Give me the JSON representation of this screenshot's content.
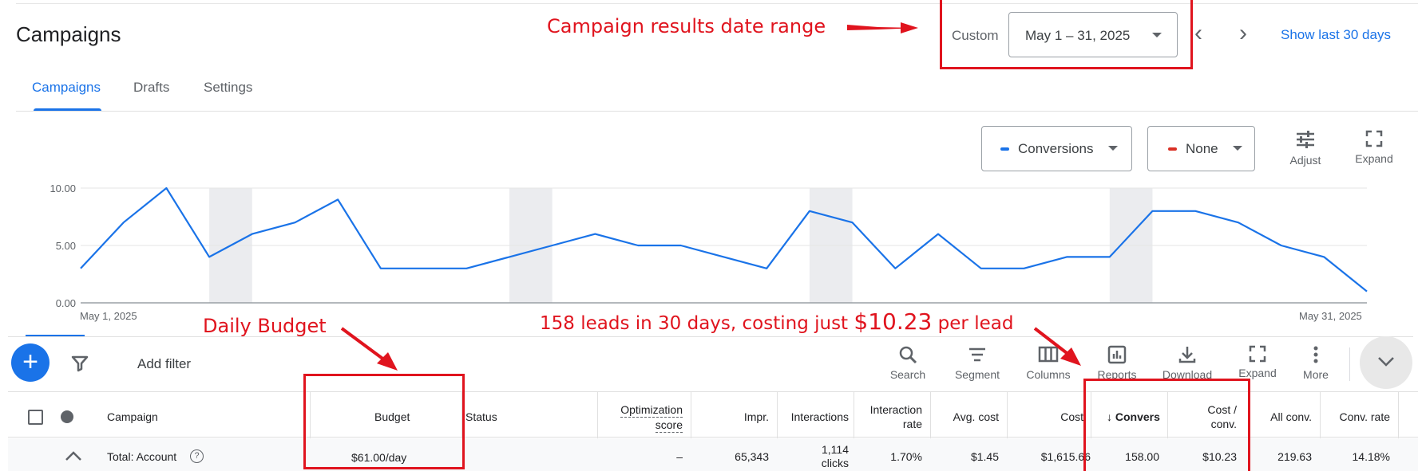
{
  "header": {
    "title": "Campaigns",
    "date_mode": "Custom",
    "date_range": "May 1 – 31, 2025",
    "show_last_label": "Show last 30 days"
  },
  "tabs": [
    {
      "label": "Campaigns",
      "active": true
    },
    {
      "label": "Drafts",
      "active": false
    },
    {
      "label": "Settings",
      "active": false
    }
  ],
  "chart_controls": {
    "metric1": {
      "label": "Conversions",
      "color": "#1a73e8"
    },
    "metric2": {
      "label": "None",
      "color": "#d93025"
    },
    "adjust_label": "Adjust",
    "expand_label": "Expand"
  },
  "chart_data": {
    "type": "line",
    "y_ticks": [
      "10.00",
      "5.00",
      "0.00"
    ],
    "ylim": [
      0,
      10
    ],
    "x_start_label": "May 1, 2025",
    "x_end_label": "May 31, 2025",
    "series": [
      {
        "color": "#1a73e8",
        "values": [
          3,
          7,
          10,
          4,
          6,
          7,
          9,
          3,
          3,
          3,
          4,
          5,
          6,
          5,
          5,
          4,
          3,
          8,
          7,
          3,
          6,
          3,
          3,
          4,
          4,
          8,
          8,
          7,
          5,
          4,
          1
        ]
      }
    ],
    "weekend_bands": [
      [
        3,
        4
      ],
      [
        10,
        11
      ],
      [
        17,
        18
      ],
      [
        24,
        25
      ]
    ]
  },
  "toolbar": {
    "add_filter": "Add filter",
    "tools": [
      "Search",
      "Segment",
      "Columns",
      "Reports",
      "Download",
      "Expand",
      "More"
    ]
  },
  "table": {
    "headers": {
      "campaign": "Campaign",
      "budget": "Budget",
      "status": "Status",
      "opt_score_1": "Optimization",
      "opt_score_2": "score",
      "impr": "Impr.",
      "interactions": "Interactions",
      "int_rate_1": "Interaction",
      "int_rate_2": "rate",
      "avg_cost": "Avg. cost",
      "cost": "Cost",
      "conversions": "Convers",
      "cost_conv_1": "Cost /",
      "cost_conv_2": "conv.",
      "all_conv": "All conv.",
      "conv_rate": "Conv. rate"
    },
    "total": {
      "label": "Total: Account",
      "budget": "$61.00/day",
      "opt_score": "–",
      "impr": "65,343",
      "interactions_1": "1,114",
      "interactions_2": "clicks",
      "int_rate": "1.70%",
      "avg_cost": "$1.45",
      "cost": "$1,615.66",
      "conversions": "158.00",
      "cost_conv": "$10.23",
      "all_conv": "219.63",
      "conv_rate": "14.18%"
    }
  },
  "annotations": {
    "date_range": "Campaign results date range",
    "budget": "Daily Budget",
    "leads_prefix": "158 leads in 30 days, costing just ",
    "leads_amount": "$10.23",
    "leads_suffix": " per lead",
    "color": "#e0141e"
  }
}
